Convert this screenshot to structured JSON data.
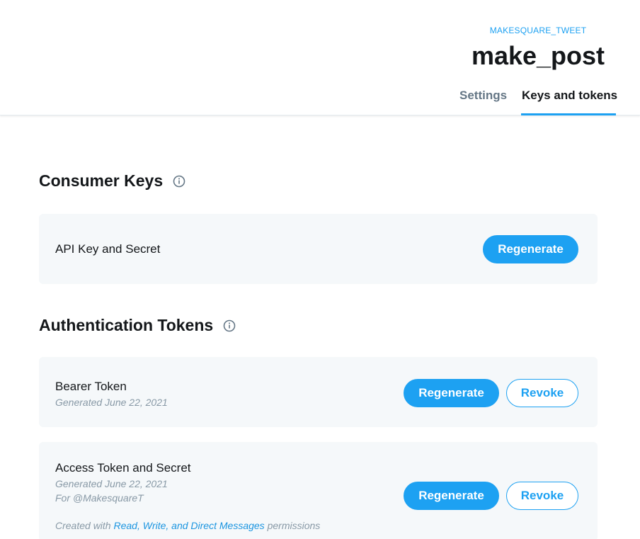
{
  "header": {
    "project_name": "MAKESQUARE_TWEET",
    "app_name": "make_post",
    "tabs": [
      {
        "label": "Settings",
        "active": false
      },
      {
        "label": "Keys and tokens",
        "active": true
      }
    ]
  },
  "consumer_keys": {
    "title": "Consumer Keys",
    "info_icon": "info-icon",
    "item": {
      "label": "API Key and Secret",
      "regenerate_label": "Regenerate"
    }
  },
  "auth_tokens": {
    "title": "Authentication Tokens",
    "info_icon": "info-icon",
    "bearer": {
      "label": "Bearer Token",
      "generated": "Generated June 22, 2021",
      "regenerate_label": "Regenerate",
      "revoke_label": "Revoke"
    },
    "access": {
      "label": "Access Token and Secret",
      "generated": "Generated June 22, 2021",
      "for_user": "For @MakesquareT",
      "perm_prefix": "Created with",
      "perm_link": "Read, Write, and Direct Messages",
      "perm_suffix": "permissions",
      "regenerate_label": "Regenerate",
      "revoke_label": "Revoke"
    }
  },
  "colors": {
    "accent": "#1da1f2",
    "card_bg": "#f5f8fa",
    "muted": "#8899a6",
    "text": "#14171a"
  }
}
